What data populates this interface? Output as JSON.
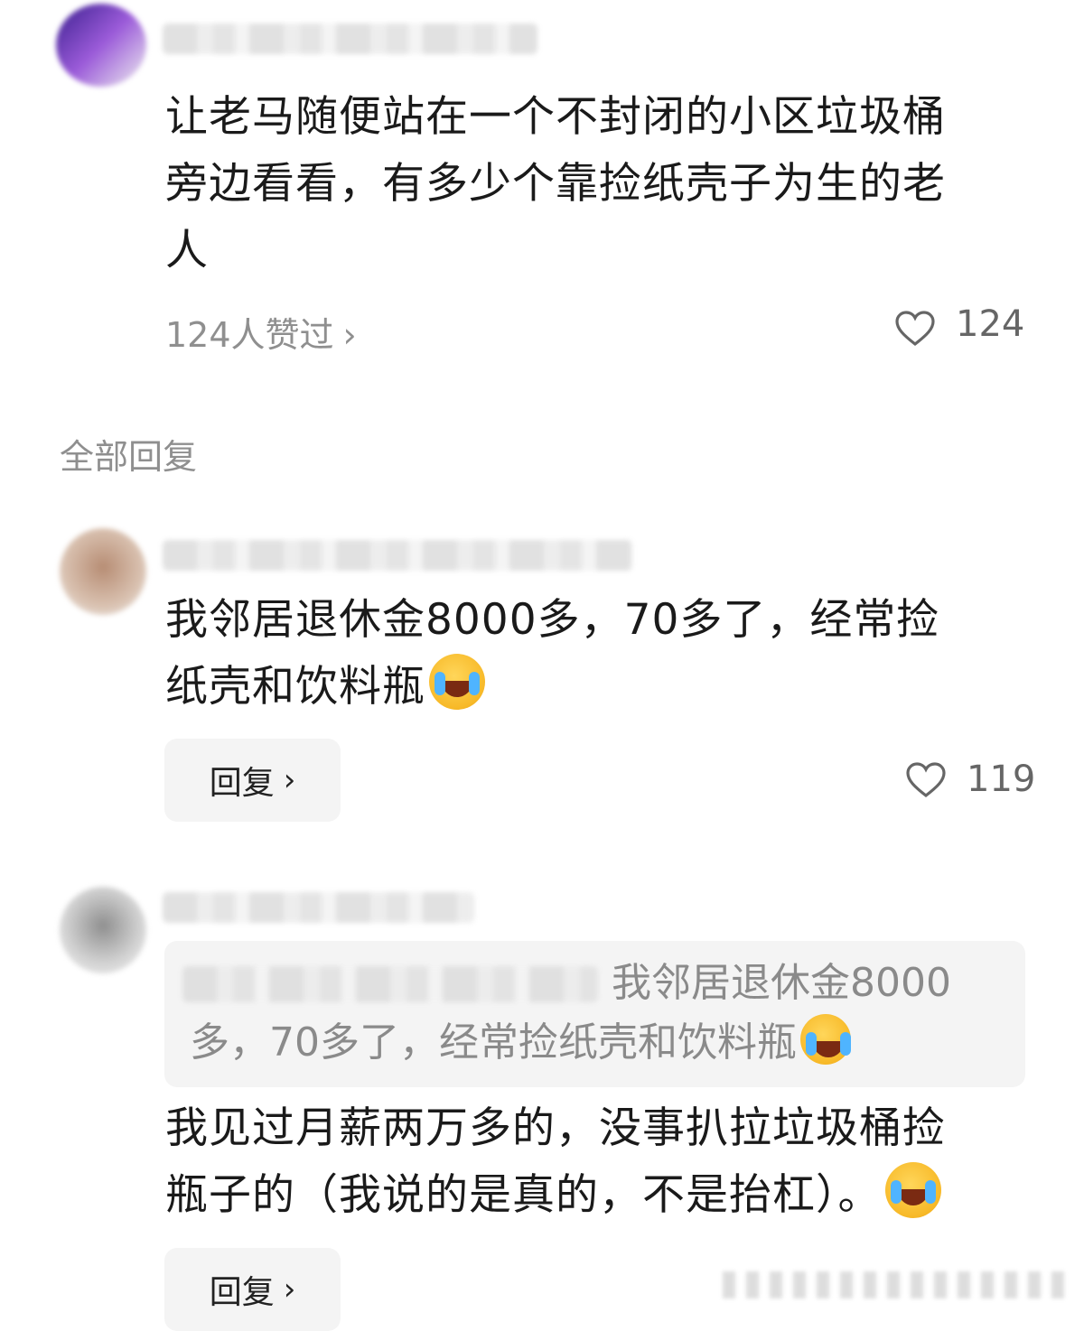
{
  "main_comment": {
    "text_lines": [
      "让老马随便站在一个不封闭的小区垃圾桶",
      "旁边看看，有多少个靠捡纸壳子为生的老",
      "人"
    ],
    "likes_summary": "124人赞过",
    "likes_chevron": "›",
    "like_count": "124"
  },
  "section": {
    "label": "全部回复"
  },
  "reply1": {
    "text_lines": [
      "我邻居退休金8000多，70多了，经常捡",
      "纸壳和饮料瓶"
    ],
    "reply_label": "回复",
    "reply_chevron": "›",
    "like_count": "119"
  },
  "reply2": {
    "quote_line1": "我邻居退休金8000",
    "quote_line2": "多，70多了，经常捡纸壳和饮料瓶",
    "text_lines": [
      "我见过月薪两万多的，没事扒拉垃圾桶捡",
      "瓶子的（我说的是真的，不是抬杠）。"
    ],
    "reply_label": "回复",
    "reply_chevron": "›"
  },
  "icons": {
    "emoji_1": "laughing-tears-emoji",
    "emoji_2": "laughing-tears-emoji",
    "heart": "heart-outline-icon"
  }
}
